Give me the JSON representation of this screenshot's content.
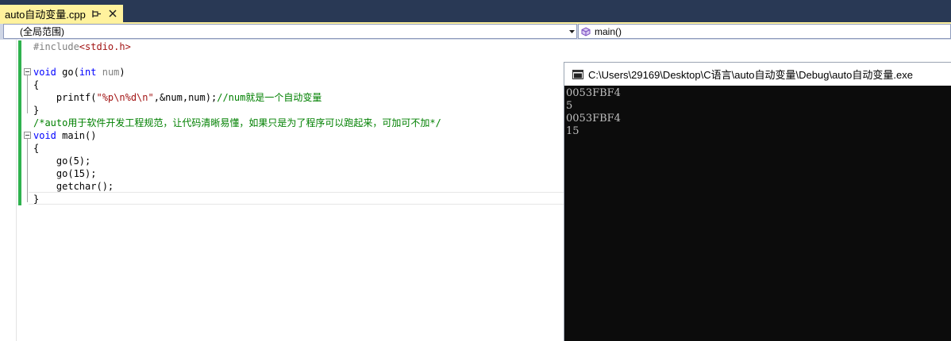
{
  "tab": {
    "title": "auto自动变量.cpp",
    "pin_icon": "pin-icon",
    "close_icon": "close-icon",
    "accent_color": "#fff29d"
  },
  "nav": {
    "scope": "(全局范围)",
    "function": "main()",
    "function_icon": "method-icon"
  },
  "code": {
    "line1": {
      "directive": "#include",
      "header": "<stdio.h>"
    },
    "line3": {
      "kw": "void",
      "name": " go(",
      "type": "int",
      "param": " num",
      "close": ")"
    },
    "line4": "{",
    "line5": {
      "indent": "    printf(",
      "fmt": "\"%p\\n%d\\n\"",
      "args": ",&num,num);",
      "comment": "//num就是一个自动变量"
    },
    "line6": "}",
    "line7": "/*auto用于软件开发工程规范，让代码清晰易懂，如果只是为了程序可以跑起来，可加可不加*/",
    "line8": {
      "kw": "void",
      "rest": " main()"
    },
    "line9": "{",
    "line10": "    go(5);",
    "line11": "    go(15);",
    "line12": "    getchar();",
    "line13": "}"
  },
  "console": {
    "title": "C:\\Users\\29169\\Desktop\\C语言\\auto自动变量\\Debug\\auto自动变量.exe",
    "icon": "console-window-icon",
    "output": [
      "0053FBF4",
      "5",
      "0053FBF4",
      "15"
    ]
  },
  "colors": {
    "tab_strip": "#293955",
    "keyword": "#0000ff",
    "string": "#a31515",
    "comment": "#008000",
    "change_bar": "#2fb24e",
    "console_bg": "#0c0c0c"
  }
}
